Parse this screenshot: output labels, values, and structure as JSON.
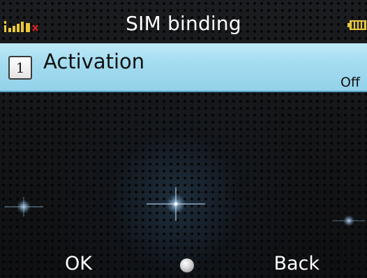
{
  "status_bar": {
    "title": "SIM binding",
    "signal_icon": "signal-strength-icon",
    "no_sim_mark_icon": "red-x-icon",
    "battery_icon": "battery-icon"
  },
  "list": {
    "items": [
      {
        "number": "1",
        "label": "Activation",
        "value": "Off"
      }
    ]
  },
  "softkeys": {
    "left": "OK",
    "center_icon": "center-key-icon",
    "right": "Back"
  },
  "colors": {
    "highlight": "#a4dcf0",
    "background": "#141517",
    "text_light": "#ffffff",
    "no_sim_mark": "#e02020"
  }
}
